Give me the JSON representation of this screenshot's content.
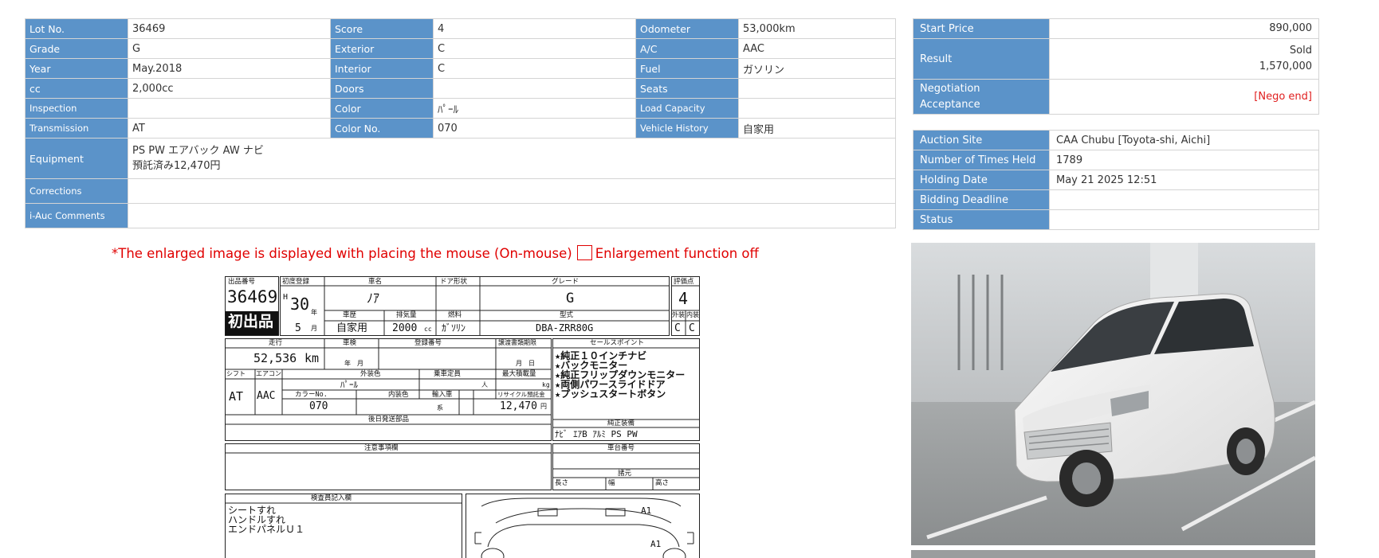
{
  "lot": {
    "lot_no_label": "Lot No.",
    "lot_no": "36469",
    "score_label": "Score",
    "score": "4",
    "odometer_label": "Odometer",
    "odometer": "53,000km",
    "grade_label": "Grade",
    "grade": "G",
    "exterior_label": "Exterior",
    "exterior": "C",
    "ac_label": "A/C",
    "ac": "AAC",
    "year_label": "Year",
    "year": "May.2018",
    "interior_label": "Interior",
    "interior": "C",
    "fuel_label": "Fuel",
    "fuel": "ガソリン",
    "cc_label": "cc",
    "cc": "2,000cc",
    "doors_label": "Doors",
    "doors": "",
    "seats_label": "Seats",
    "seats": "",
    "inspection_label": "Inspection",
    "inspection": "",
    "color_label": "Color",
    "color": "ﾊﾟｰﾙ",
    "load_label": "Load Capacity",
    "load": "",
    "transmission_label": "Transmission",
    "transmission": "AT",
    "color_no_label": "Color No.",
    "color_no": "070",
    "history_label": "Vehicle History",
    "history": "自家用",
    "equipment_label": "Equipment",
    "equipment_line1": "PS PW エアバック AW ナビ",
    "equipment_line2": "預託済み12,470円",
    "corrections_label": "Corrections",
    "corrections": "",
    "comments_label": "i-Auc Comments",
    "comments": ""
  },
  "price": {
    "start_label": "Start Price",
    "start": "890,000",
    "result_label": "Result",
    "result_status": "Sold",
    "result_price": "1,570,000",
    "nego_label_line1": "Negotiation",
    "nego_label_line2": "Acceptance",
    "nego": "[Nego end]"
  },
  "auction": {
    "site_label": "Auction Site",
    "site": "CAA Chubu [Toyota-shi, Aichi]",
    "times_label": "Number of Times Held",
    "times": "1789",
    "date_label": "Holding Date",
    "date": "May 21 2025 12:51",
    "deadline_label": "Bidding Deadline",
    "deadline": "",
    "status_label": "Status",
    "status": ""
  },
  "notice": {
    "text": "*The enlarged image is displayed with placing the mouse (On-mouse)",
    "checkbox_label": "Enlargement function off"
  },
  "sheet": {
    "h_lot": "出品番号",
    "h_reg": "初度登録",
    "h_name": "車名",
    "h_door": "ドア形状",
    "h_grade": "グレード",
    "h_score": "評価点",
    "lot": "36469",
    "era": "H",
    "era_year": "30",
    "year_unit": "年",
    "name": "ﾉｱ",
    "grade": "G",
    "score": "4",
    "first": "初出品",
    "month": "5",
    "month_unit": "月",
    "h_type": "車歴",
    "h_disp": "排気量",
    "h_fuel": "燃料",
    "h_model": "型式",
    "h_ext": "外装",
    "h_int": "内装",
    "type": "自家用",
    "disp": "2000",
    "disp_unit": "cc",
    "fuel": "ｶﾞｿﾘﾝ",
    "model": "DBA-ZRR80G",
    "ext": "C",
    "int": "C",
    "h_mileage": "走行",
    "h_shaken": "車検",
    "h_regno": "登録番号",
    "h_transfer": "譲渡書類期限",
    "h_points": "セールスポイント",
    "mileage": "52,536",
    "mileage_unit": "km",
    "shaken_unit": "年　月",
    "transfer_unit": "月　日",
    "h_shift": "シフト",
    "h_ac": "エアコン",
    "h_color": "外装色",
    "h_seating": "乗車定員",
    "h_load": "最大積載量",
    "shift": "AT",
    "ac": "AAC",
    "color": "ﾊﾟｰﾙ",
    "seat_unit": "人",
    "load_unit": "kg",
    "h_colorno": "カラーNo.",
    "h_intcolor": "内装色",
    "h_import": "輸入車",
    "h_recycle": "リサイクル預託金",
    "colorno": "070",
    "int_unit": "系",
    "recycle": "12,470",
    "recycle_unit": "円",
    "points": [
      "★純正１０インチナビ",
      "★バックモニター",
      "★純正フリップダウンモニター",
      "★両側パワースライドドア",
      "★プッシュスタートボタン"
    ],
    "h_later": "後日発送部品",
    "h_equip": "純正装備",
    "equip": "ﾅﾋﾞ ｴｱB ｱﾙﾐ PS PW",
    "h_notes": "注意事項欄",
    "h_chassis": "車台番号",
    "h_dims": "諸元",
    "h_len": "長さ",
    "h_wid": "幅",
    "h_hgt": "高さ",
    "h_inspector": "検査員記入欄",
    "inspector_notes": [
      "シートすれ",
      "ハンドルすれ",
      "エンドパネルＵ１"
    ],
    "diag_a1": "A1",
    "diag_a1b": "A1"
  },
  "photo": {
    "main_alt": "white minivan in inspection bay"
  }
}
